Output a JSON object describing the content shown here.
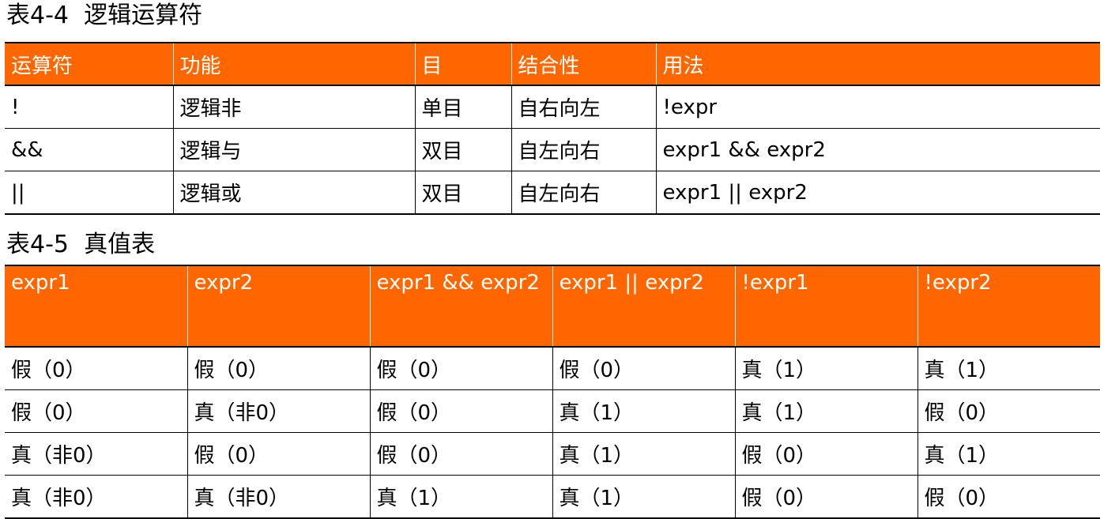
{
  "table1": {
    "caption": "表4-4  逻辑运算符",
    "headers": [
      "运算符",
      "功能",
      "目",
      "结合性",
      "用法"
    ],
    "rows": [
      [
        "!",
        "逻辑非",
        "单目",
        "自右向左",
        "!expr"
      ],
      [
        "&&",
        "逻辑与",
        "双目",
        "自左向右",
        "expr1 && expr2"
      ],
      [
        "||",
        "逻辑或",
        "双目",
        "自左向右",
        "expr1 || expr2"
      ]
    ]
  },
  "table2": {
    "caption": "表4-5  真值表",
    "headers": [
      "expr1",
      "expr2",
      "expr1 && expr2",
      "expr1 || expr2",
      "!expr1",
      "!expr2"
    ],
    "rows": [
      [
        "假（0）",
        "假（0）",
        "假（0）",
        "假（0）",
        "真（1）",
        "真（1）"
      ],
      [
        "假（0）",
        "真（非0）",
        "假（0）",
        "真（1）",
        "真（1）",
        "假（0）"
      ],
      [
        "真（非0）",
        "假（0）",
        "假（0）",
        "真（1）",
        "假（0）",
        "真（1）"
      ],
      [
        "真（非0）",
        "真（非0）",
        "真（1）",
        "真（1）",
        "假（0）",
        "假（0）"
      ]
    ]
  },
  "colors": {
    "header_bg": "#ff6600",
    "header_text": "#ffffff",
    "border": "#000000"
  }
}
